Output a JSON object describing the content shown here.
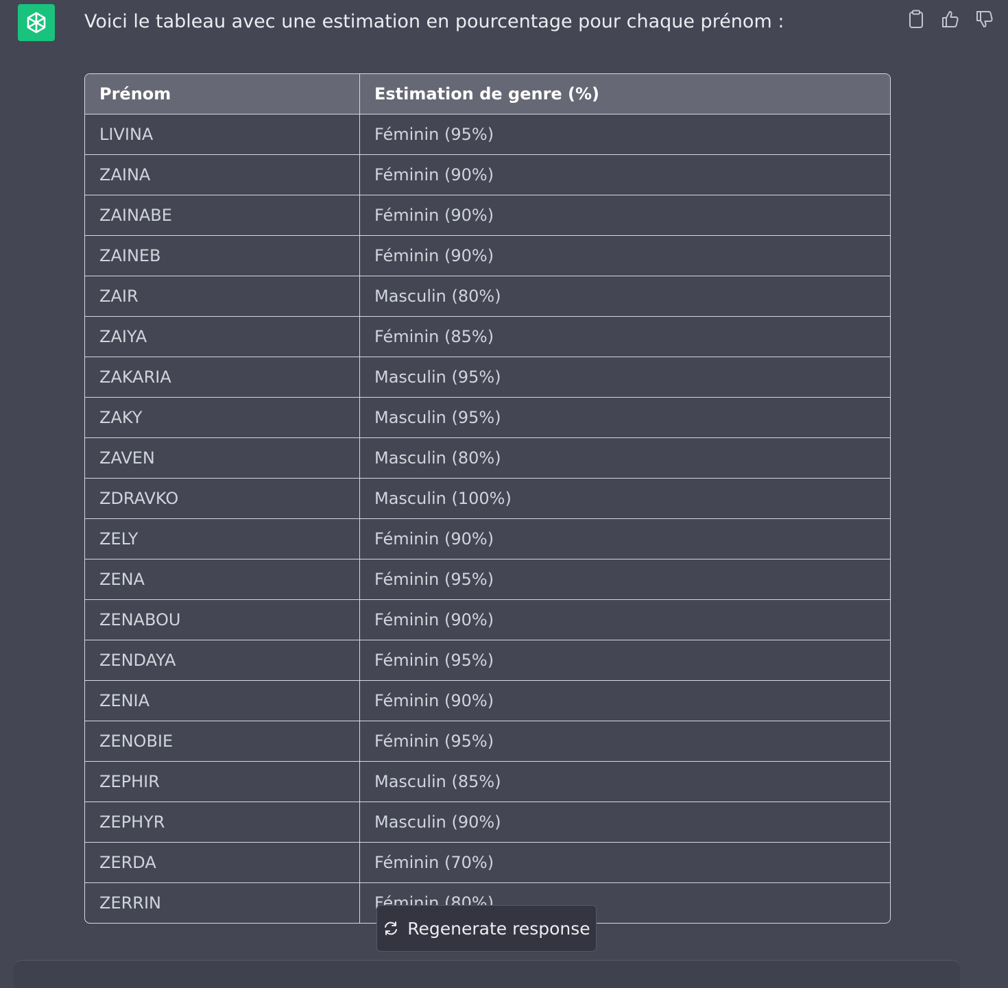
{
  "message": {
    "text": "Voici le tableau avec une estimation en pourcentage pour chaque prénom :"
  },
  "icons": {
    "avatar": "openai-logo-icon",
    "copy": "clipboard-icon",
    "like": "thumbs-up-icon",
    "dislike": "thumbs-down-icon",
    "regenerate": "refresh-icon"
  },
  "colors": {
    "avatar_bg": "#19c37d",
    "page_bg": "#444654",
    "header_bg": "#676875"
  },
  "table": {
    "headers": [
      "Prénom",
      "Estimation de genre (%)"
    ],
    "rows": [
      [
        "LIVINA",
        "Féminin (95%)"
      ],
      [
        "ZAINA",
        "Féminin (90%)"
      ],
      [
        "ZAINABE",
        "Féminin (90%)"
      ],
      [
        "ZAINEB",
        "Féminin (90%)"
      ],
      [
        "ZAIR",
        "Masculin (80%)"
      ],
      [
        "ZAIYA",
        "Féminin (85%)"
      ],
      [
        "ZAKARIA",
        "Masculin (95%)"
      ],
      [
        "ZAKY",
        "Masculin (95%)"
      ],
      [
        "ZAVEN",
        "Masculin (80%)"
      ],
      [
        "ZDRAVKO",
        "Masculin (100%)"
      ],
      [
        "ZELY",
        "Féminin (90%)"
      ],
      [
        "ZENA",
        "Féminin (95%)"
      ],
      [
        "ZENABOU",
        "Féminin (90%)"
      ],
      [
        "ZENDAYA",
        "Féminin (95%)"
      ],
      [
        "ZENIA",
        "Féminin (90%)"
      ],
      [
        "ZENOBIE",
        "Féminin (95%)"
      ],
      [
        "ZEPHIR",
        "Masculin (85%)"
      ],
      [
        "ZEPHYR",
        "Masculin (90%)"
      ],
      [
        "ZERDA",
        "Féminin (70%)"
      ],
      [
        "ZERRIN",
        "Féminin (80%)"
      ]
    ]
  },
  "regenerate": {
    "label": "Regenerate response"
  }
}
